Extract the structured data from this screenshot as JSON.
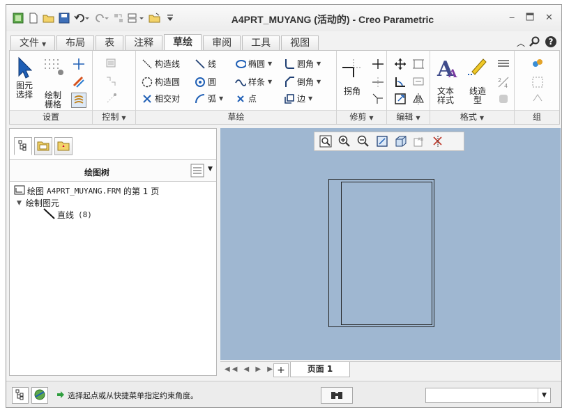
{
  "window": {
    "title": "A4PRT_MUYANG (活动的) - Creo Parametric",
    "controls": [
      "minimize-icon",
      "restore-icon",
      "close-icon"
    ]
  },
  "tabs": [
    {
      "label": "文件",
      "has_dropdown": true
    },
    {
      "label": "布局"
    },
    {
      "label": "表"
    },
    {
      "label": "注释"
    },
    {
      "label": "草绘",
      "active": true
    },
    {
      "label": "审阅"
    },
    {
      "label": "工具"
    },
    {
      "label": "视图"
    }
  ],
  "ribbon": {
    "setup": {
      "label": "设置",
      "select_label_1": "图元",
      "select_label_2": "选择",
      "grid_label_1": "绘制",
      "grid_label_2": "栅格"
    },
    "control": {
      "label": "控制"
    },
    "sketch": {
      "label": "草绘",
      "construction_line": "构造线",
      "construction_circle": "构造圆",
      "relative_coords": "相交对",
      "line": "线",
      "circle": "圆",
      "arc": "弧",
      "ellipse": "椭圆",
      "spline": "样条",
      "point": "点",
      "fillet": "圆角",
      "chamfer": "倒角",
      "edge": "边"
    },
    "trim": {
      "label": "修剪",
      "corner": "拐角"
    },
    "edit": {
      "label": "编辑"
    },
    "format": {
      "label": "格式",
      "text_style_1": "文本",
      "text_style_2": "样式",
      "line_style_1": "线造",
      "line_style_2": "型"
    },
    "group": {
      "label": "组"
    }
  },
  "panel": {
    "tree_title": "绘图树",
    "tree": {
      "root_prefix": "绘图",
      "root_name": "A4PRT_MUYANG.FRM",
      "root_suffix": "的第 1 页",
      "folder": "绘制图元",
      "item_label": "直线",
      "item_count": "(8)"
    }
  },
  "canvas": {
    "background": "#9fb7d1"
  },
  "pagebar": {
    "page_tab": "页面 1",
    "add_label": "+"
  },
  "status": {
    "message": "选择起点或从快捷菜单指定约束角度。",
    "filter_value": ""
  }
}
